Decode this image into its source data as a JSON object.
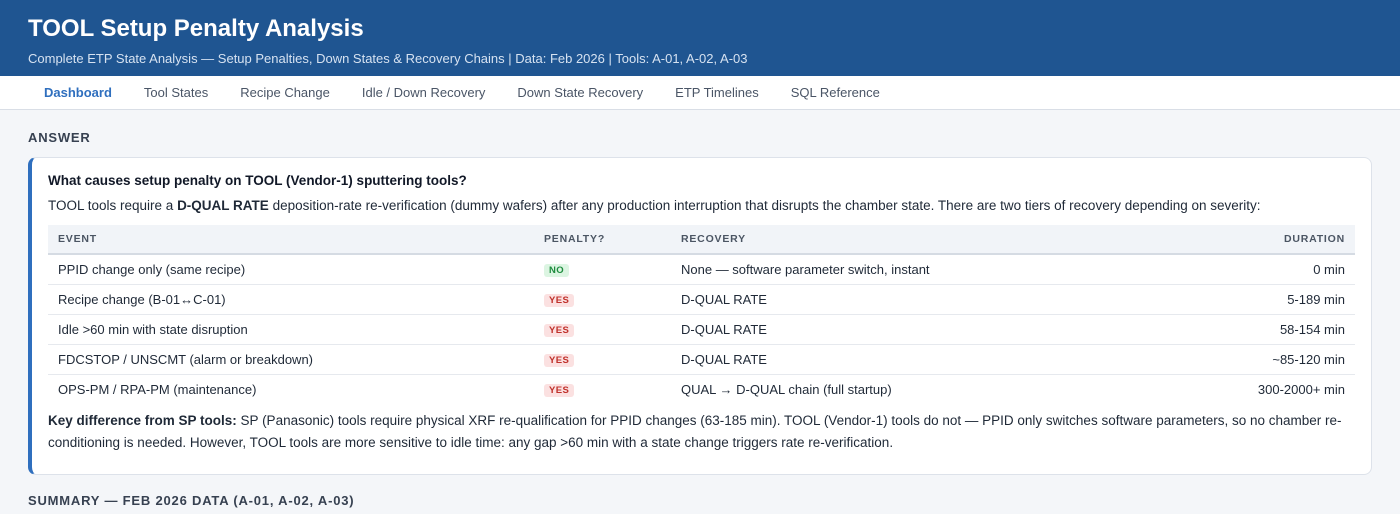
{
  "header": {
    "title": "TOOL Setup Penalty Analysis",
    "subtitle": "Complete ETP State Analysis — Setup Penalties, Down States & Recovery Chains | Data: Feb 2026 | Tools: A-01, A-02, A-03"
  },
  "nav": {
    "tabs": [
      {
        "label": "Dashboard",
        "active": true
      },
      {
        "label": "Tool States"
      },
      {
        "label": "Recipe Change"
      },
      {
        "label": "Idle / Down Recovery"
      },
      {
        "label": "Down State Recovery"
      },
      {
        "label": "ETP Timelines"
      },
      {
        "label": "SQL Reference"
      }
    ]
  },
  "answer": {
    "section_title": "ANSWER",
    "question": "What causes setup penalty on TOOL (Vendor-1) sputtering tools?",
    "intro_pre": "TOOL tools require a ",
    "intro_bold": "D-QUAL RATE",
    "intro_post": " deposition-rate re-verification (dummy wafers) after any production interruption that disrupts the chamber state. There are two tiers of recovery depending on severity:",
    "table": {
      "headers": {
        "event": "EVENT",
        "penalty": "PENALTY?",
        "recovery": "RECOVERY",
        "duration": "DURATION"
      },
      "rows": [
        {
          "event": "PPID change only (same recipe)",
          "penalty": "NO",
          "recovery": "None — software parameter switch, instant",
          "duration": "0 min"
        },
        {
          "event": "Recipe change (B-01↔C-01)",
          "penalty": "YES",
          "recovery": "D-QUAL RATE",
          "duration": "5-189 min"
        },
        {
          "event": "Idle >60 min with state disruption",
          "penalty": "YES",
          "recovery": "D-QUAL RATE",
          "duration": "58-154 min"
        },
        {
          "event": "FDCSTOP / UNSCMT (alarm or breakdown)",
          "penalty": "YES",
          "recovery": "D-QUAL RATE",
          "duration": "~85-120 min"
        },
        {
          "event": "OPS-PM / RPA-PM (maintenance)",
          "penalty": "YES",
          "recovery": "QUAL → D-QUAL chain (full startup)",
          "duration": "300-2000+ min"
        }
      ]
    },
    "key_label": "Key difference from SP tools:",
    "key_text": " SP (Panasonic) tools require physical XRF re-qualification for PPID changes (63-185 min). TOOL (Vendor-1) tools do not — PPID only switches software parameters, so no chamber re-conditioning is needed. However, TOOL tools are more sensitive to idle time: any gap >60 min with a state change triggers rate re-verification."
  },
  "summary": {
    "section_title": "SUMMARY — FEB 2026 DATA (A-01, A-02, A-03)"
  },
  "colors": {
    "header_bg": "#1f5591",
    "accent": "#2f6fbe",
    "badge_no": "#1e8c3e",
    "badge_yes": "#c0312b"
  }
}
